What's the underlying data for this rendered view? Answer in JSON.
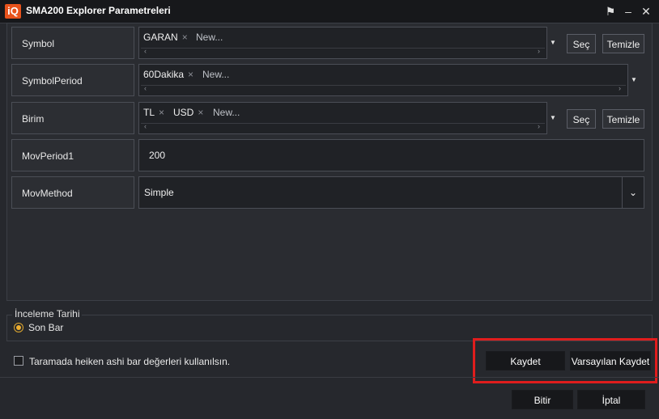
{
  "window": {
    "logo": "iQ",
    "title": "SMA200 Explorer Parametreleri",
    "pin_icon": "pin-icon",
    "minimize_icon": "minimize-icon",
    "close_icon": "close-icon"
  },
  "params": {
    "symbol": {
      "label": "Symbol",
      "chips": [
        "GARAN"
      ],
      "placeholder": "New...",
      "sec_label": "Seç",
      "temizle_label": "Temizle"
    },
    "symbol_period": {
      "label": "SymbolPeriod",
      "chips": [
        "60Dakika"
      ],
      "placeholder": "New..."
    },
    "birim": {
      "label": "Birim",
      "chips": [
        "TL",
        "USD"
      ],
      "placeholder": "New...",
      "sec_label": "Seç",
      "temizle_label": "Temizle"
    },
    "mov_period1": {
      "label": "MovPeriod1",
      "value": "200"
    },
    "mov_method": {
      "label": "MovMethod",
      "value": "Simple"
    }
  },
  "inceleme": {
    "legend": "İnceleme Tarihi",
    "option_label": "Son Bar",
    "selected": true
  },
  "heiken": {
    "label": "Taramada heiken ashi bar değerleri kullanılsın.",
    "checked": false
  },
  "actions": {
    "kaydet": "Kaydet",
    "varsayilan_kaydet": "Varsayılan Kaydet",
    "bitir": "Bitir",
    "iptal": "İptal"
  },
  "colors": {
    "accent": "#e8531c",
    "highlight": "#e01d1d",
    "radio": "#f0b030"
  }
}
